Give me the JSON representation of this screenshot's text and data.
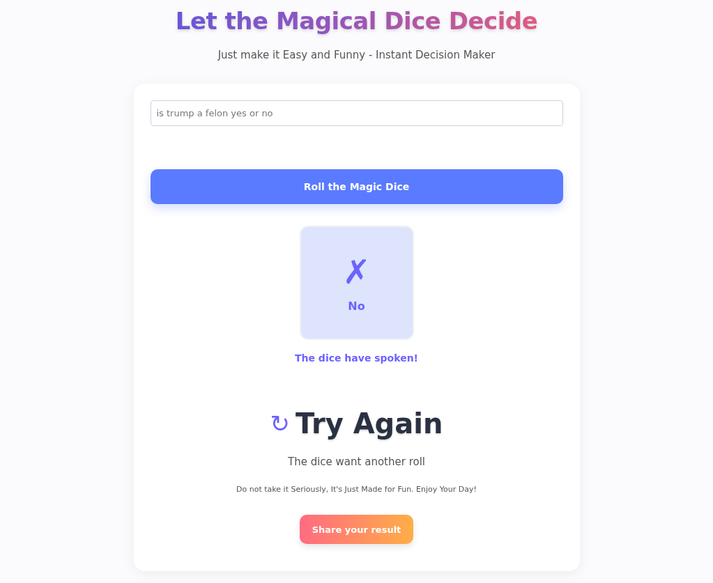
{
  "title": "Let the Magical Dice Decide",
  "subtitle": "Just make it Easy and Funny - Instant Decision Maker",
  "question_field": {
    "value": "is trump a felon yes or no"
  },
  "roll_button": "Roll the Magic Dice",
  "dice": {
    "symbol": "✗",
    "answer": "No"
  },
  "dice_message": "The dice have spoken!",
  "result": {
    "icon": "↻",
    "heading": "Try Again",
    "caption": "The dice want another roll"
  },
  "disclaimer": "Do not take it Seriously, It's Just Made for Fun. Enjoy Your Day!",
  "share_button": "Share your result"
}
